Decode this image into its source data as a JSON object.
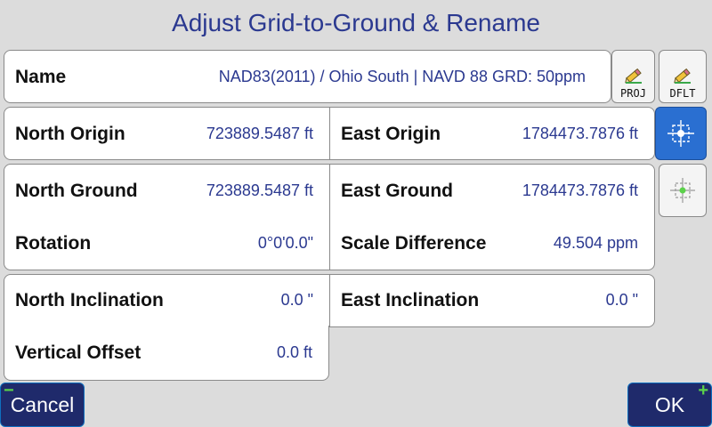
{
  "title": "Adjust Grid-to-Ground & Rename",
  "name_row": {
    "label": "Name",
    "value": "NAD83(2011) / Ohio South | NAVD 88 GRD: 50ppm",
    "proj_button": "PROJ",
    "dflt_button": "DFLT"
  },
  "origin_row": {
    "north_label": "North Origin",
    "north_value": "723889.5487 ft",
    "east_label": "East Origin",
    "east_value": "1784473.7876 ft"
  },
  "ground_panel": {
    "north_label": "North Ground",
    "north_value": "723889.5487 ft",
    "east_label": "East Ground",
    "east_value": "1784473.7876 ft",
    "rotation_label": "Rotation",
    "rotation_value": "0°0'0.0\"",
    "scale_label": "Scale Difference",
    "scale_value": "49.504 ppm"
  },
  "inclination_panel": {
    "north_label": "North Inclination",
    "north_value": "0.0 \"",
    "east_label": "East Inclination",
    "east_value": "0.0 \"",
    "vertical_label": "Vertical Offset",
    "vertical_value": "0.0 ft"
  },
  "footer": {
    "cancel_label": "Cancel",
    "ok_label": "OK",
    "cancel_sign": "−",
    "ok_sign": "+"
  },
  "colors": {
    "accent": "#2b3990",
    "active_target": "#2a6fd1",
    "footer_button": "#1f2a6b",
    "sign_green": "#5bd24a"
  },
  "icons": {
    "proj": "edit-pencil-icon",
    "dflt": "edit-pencil-icon",
    "origin_target": "crosshair-icon",
    "ground_target": "crosshair-icon"
  }
}
